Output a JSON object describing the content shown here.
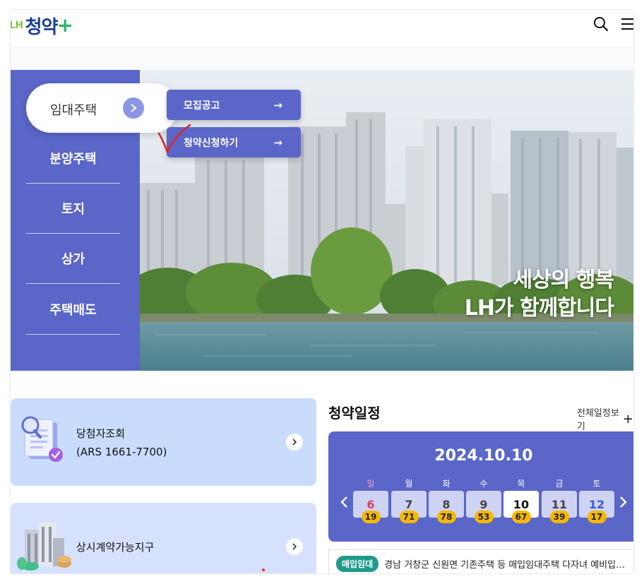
{
  "header": {
    "logo_lh": "LH",
    "logo_main": "청약",
    "logo_plus": "+",
    "search_icon": "search-icon",
    "menu_icon": "hamburger-menu-icon"
  },
  "hero": {
    "nav": [
      {
        "label": "임대주택",
        "active": true
      },
      {
        "label": "분양주택"
      },
      {
        "label": "토지"
      },
      {
        "label": "상가"
      },
      {
        "label": "주택매도"
      }
    ],
    "submenu": [
      {
        "label": "모집공고",
        "icon": "arrow-right-icon"
      },
      {
        "label": "청약신청하기",
        "icon": "arrow-right-icon"
      }
    ],
    "slogan_line1": "세상의 행복",
    "slogan_line2": "LH가 함께합니다",
    "colors": {
      "panel": "#5a66c8",
      "active_arrow": "#8d96e2"
    }
  },
  "cards": [
    {
      "title_line1": "당첨자조회",
      "title_line2": "(ARS 1661-7700)",
      "icon": "document-search-icon"
    },
    {
      "title_line1": "상시계약가능지구",
      "icon": "apartment-building-icon"
    }
  ],
  "schedule": {
    "title": "청약일정",
    "view_all": "전체일정보기",
    "view_all_icon": "+",
    "date": "2024.10.10",
    "days": [
      {
        "name": "일",
        "num": "6",
        "count": "19",
        "kind": "sun"
      },
      {
        "name": "월",
        "num": "7",
        "count": "71"
      },
      {
        "name": "화",
        "num": "8",
        "count": "78"
      },
      {
        "name": "수",
        "num": "9",
        "count": "53"
      },
      {
        "name": "목",
        "num": "10",
        "count": "67",
        "kind": "today"
      },
      {
        "name": "금",
        "num": "11",
        "count": "39"
      },
      {
        "name": "토",
        "num": "12",
        "count": "17",
        "kind": "sat"
      }
    ],
    "prev_icon": "‹",
    "next_icon": "›"
  },
  "notice": {
    "tag": "매입임대",
    "text": "경남 거창군 신원면 기존주택 등 매입임대주택 다자녀 예비입주…"
  }
}
